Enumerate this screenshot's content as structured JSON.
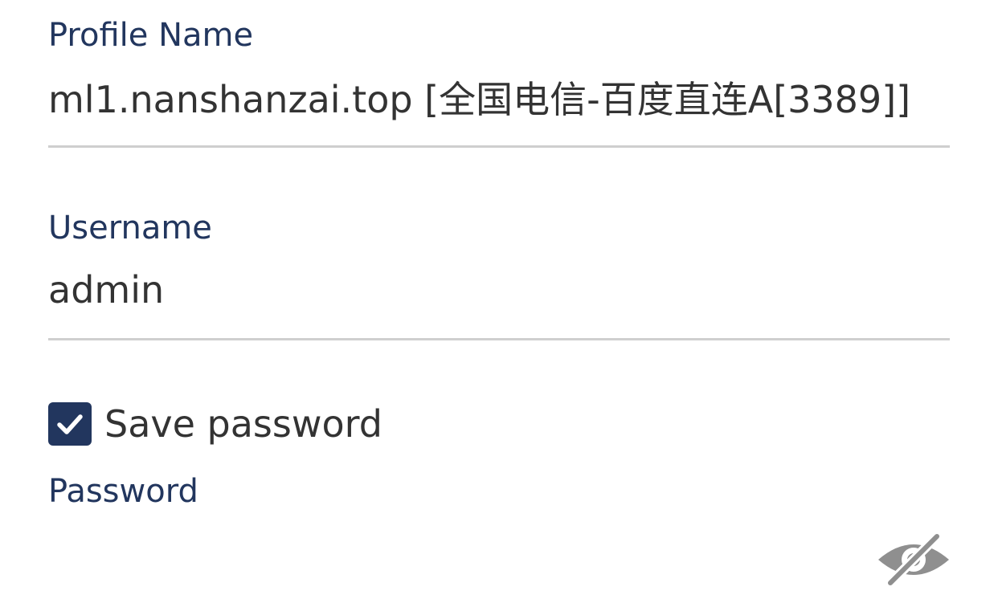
{
  "profile": {
    "label": "Profile Name",
    "value": "ml1.nanshanzai.top [全国电信-百度直连A[3389]]"
  },
  "username": {
    "label": "Username",
    "value": "admin"
  },
  "save_password": {
    "label": "Save password",
    "checked": true
  },
  "password": {
    "label": "Password",
    "value": ""
  },
  "icons": {
    "checkbox": "check-icon",
    "visibility_toggle": "eye-off-icon"
  },
  "colors": {
    "accent": "#22365e",
    "text": "#333333",
    "divider": "#cfcfcf",
    "icon": "#8f8f8f"
  }
}
